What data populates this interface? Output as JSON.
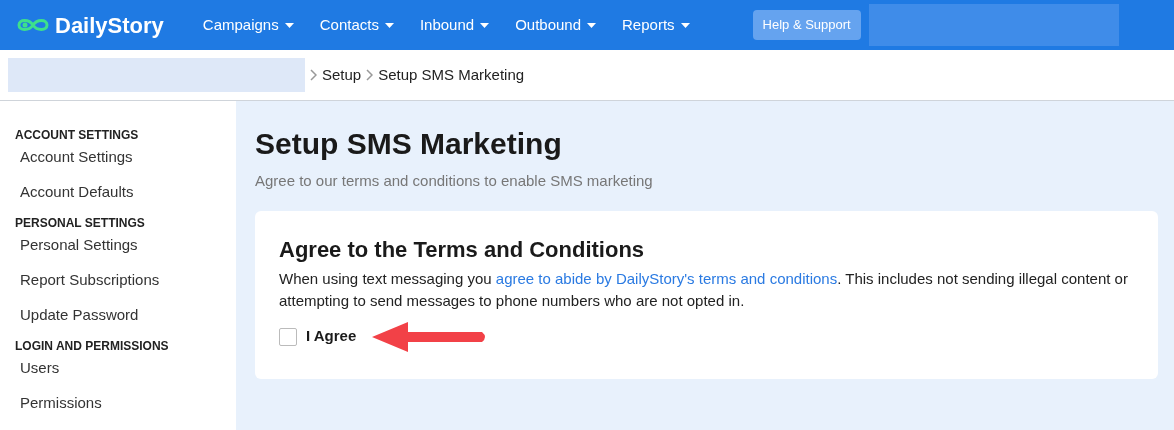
{
  "brand": {
    "name": "DailyStory"
  },
  "nav": [
    {
      "label": "Campaigns"
    },
    {
      "label": "Contacts"
    },
    {
      "label": "Inbound"
    },
    {
      "label": "Outbound"
    },
    {
      "label": "Reports"
    }
  ],
  "help_button": "Help & Support",
  "breadcrumb": [
    "Setup",
    "Setup SMS Marketing"
  ],
  "sidebar": [
    {
      "heading": "ACCOUNT SETTINGS",
      "items": [
        "Account Settings",
        "Account Defaults"
      ]
    },
    {
      "heading": "PERSONAL SETTINGS",
      "items": [
        "Personal Settings",
        "Report Subscriptions",
        "Update Password"
      ]
    },
    {
      "heading": "LOGIN AND PERMISSIONS",
      "items": [
        "Users",
        "Permissions"
      ]
    }
  ],
  "page": {
    "title": "Setup SMS Marketing",
    "subtitle": "Agree to our terms and conditions to enable SMS marketing"
  },
  "card": {
    "title": "Agree to the Terms and Conditions",
    "text_before": "When using text messaging you ",
    "link": "agree to abide by DailyStory's terms and conditions",
    "text_after": ". This includes not sending illegal content or attempting to send messages to phone numbers who are not opted in.",
    "checkbox": {
      "label": "I Agree",
      "checked": false
    }
  }
}
